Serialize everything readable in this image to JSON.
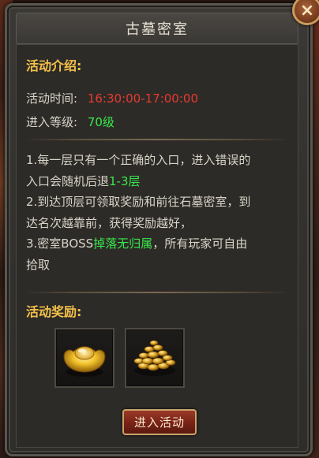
{
  "dialog": {
    "title": "古墓密室",
    "close_label": "×"
  },
  "intro": {
    "heading": "活动介绍:",
    "time_label": "活动时间:",
    "time_value": "16:30:00-17:00:00",
    "level_label": "进入等级:",
    "level_value": "70级"
  },
  "description": {
    "line1": "1.每一层只有一个正确的入口，进入错误的",
    "line2a": "入口会随机后退",
    "line2b": "1-3层",
    "line3": "2.到达顶层可领取奖励和前往石墓密室，到",
    "line4": "达名次越靠前，获得奖励越好，",
    "line5a": "3.密室BOSS",
    "line5b": "掉落无归属",
    "line5c": "，所有玩家可自由",
    "line6": "拾取"
  },
  "rewards": {
    "heading": "活动奖励:",
    "items": [
      {
        "icon": "gold-ingot-icon"
      },
      {
        "icon": "gold-coins-icon"
      }
    ]
  },
  "actions": {
    "enter_label": "进入活动"
  },
  "colors": {
    "heading": "#f3c04a",
    "time_value": "#e83a2e",
    "highlight": "#37e84a"
  }
}
